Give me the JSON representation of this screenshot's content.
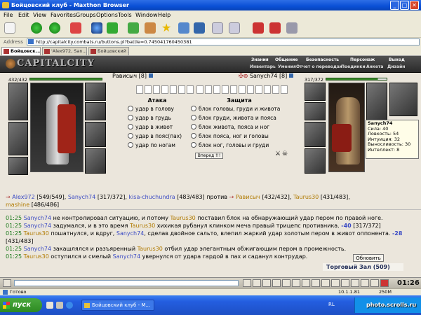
{
  "window": {
    "title": "Бойцовский клуб - Maxthon Browser"
  },
  "menu": [
    "File",
    "Edit",
    "View",
    "Favorites",
    "Groups",
    "Options",
    "Tools",
    "Window",
    "Help"
  ],
  "address": {
    "label": "Address",
    "url": "http://capitalcity.combats.ru/buttons.pl?battle=0.745041760450381"
  },
  "tabs": [
    "Бойцовск...",
    "'Alex972, San...",
    "Бойцовский ..."
  ],
  "site": {
    "logo": "CAPITALCITY",
    "nav_top": [
      "Знания",
      "Общение",
      "Безопасность",
      "Персонаж",
      "Выход"
    ],
    "nav_bottom": [
      "Инвентарь",
      "Умения",
      "Отчет о переводах",
      "Поединки",
      "Анкета",
      "Дизайн"
    ]
  },
  "fighter_left": {
    "hp": "432/432",
    "name": "Рависыч",
    "level": "[8]",
    "hp_fraction": 1.0
  },
  "fighter_right": {
    "hp": "317/372",
    "name": "Sanych74",
    "level": "[8]",
    "hp_fraction": 0.852
  },
  "attack": {
    "header": "Атака",
    "options": [
      "удар в голову",
      "удар в грудь",
      "удар в живот",
      "удар в пояс(пах)",
      "удар по ногам"
    ]
  },
  "defense": {
    "header": "Защита",
    "options": [
      "блок головы, груди и живота",
      "блок груди, живота и пояса",
      "блок живота, пояса и ног",
      "блок пояса, ног и головы",
      "блок ног, головы и груди"
    ]
  },
  "go_button": "Вперед !!!",
  "tooltip": {
    "name": "Sanych74",
    "stats": [
      "Сила: 40",
      "Ловкость: 54",
      "Интуиция: 32",
      "Выносливость: 30",
      "Интеллект: 8"
    ]
  },
  "teams": {
    "left": [
      {
        "name": "Alex972",
        "hp": "[549/549]"
      },
      {
        "name": "Sanych74",
        "hp": "[317/372]"
      },
      {
        "name": "kisa-chuchundra",
        "hp": "[483/483]"
      }
    ],
    "versus": "против",
    "right": [
      {
        "name": "Рависыч",
        "hp": "[432/432]"
      },
      {
        "name": "Taurus30",
        "hp": "[431/483]"
      },
      {
        "name": "mashine",
        "hp": "[486/486]"
      }
    ]
  },
  "log": [
    {
      "time": "01:25",
      "a": "Sanych74",
      "t1": " не контролировал ситуацию, и потому ",
      "b": "Taurus30",
      "t2": " поставил блок на обнаружающий удар пером по правой ноге.",
      "dmg": "",
      "hp": ""
    },
    {
      "time": "01:25",
      "a": "Sanych74",
      "t1": " задумался, и в это время ",
      "b": "Taurus30",
      "t2": " хихикая рубанул клинком меча правый трицепс противника.",
      "dmg": "-40",
      "hp": "[317/372]"
    },
    {
      "time": "01:25",
      "a": "Taurus30",
      "t1": " пошатнулся, и вдруг, ",
      "b": "Sanych74",
      "t2": ", сделав двойное сальто, влепил жаркий удар золотым пером в живот оппонента.",
      "dmg": "-28",
      "hp": "[431/483]"
    },
    {
      "time": "01:25",
      "a": "Sanych74",
      "t1": " закашлялся и разъяренный ",
      "b": "Taurus30",
      "t2": " отбил удар элегантным обжигающим пером в промежность.",
      "dmg": "",
      "hp": ""
    },
    {
      "time": "01:25",
      "a": "Taurus30",
      "t1": " оступился и смелый ",
      "b": "Sanych74",
      "t2": " увернулся от удара гардой в пах и саданул контрудар.",
      "dmg": "",
      "hp": ""
    }
  ],
  "refresh_button": "Обновить",
  "trade_room": "Торговый Зал (509)",
  "clock": "01:26",
  "status": {
    "ready": "Готово",
    "ip": "10.1.1.81",
    "size": "250M"
  },
  "taskbar": {
    "start": "пуск",
    "task": "Бойцовский клуб - M...",
    "lang": "RL",
    "watermark": "photo.scrolls.ru"
  }
}
